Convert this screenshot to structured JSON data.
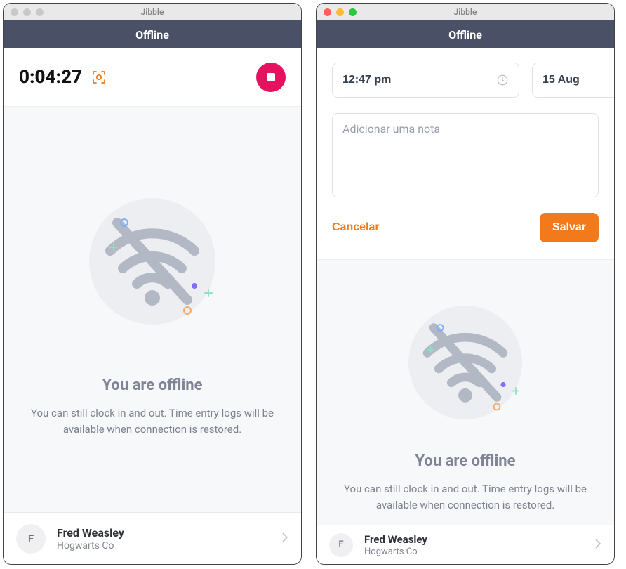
{
  "app_title": "Jibble",
  "status_label": "Offline",
  "left": {
    "timer": "0:04:27",
    "offline_heading": "You are offline",
    "offline_desc": "You can still clock in and out. Time entry logs will be available when connection is restored."
  },
  "right": {
    "time_value": "12:47 pm",
    "date_value": "15 Aug",
    "note_placeholder": "Adicionar uma nota",
    "cancel_label": "Cancelar",
    "save_label": "Salvar",
    "offline_heading": "You are offline",
    "offline_desc": "You can still clock in and out. Time entry logs will be available when connection is restored."
  },
  "user": {
    "initial": "F",
    "name": "Fred Weasley",
    "company": "Hogwarts Co"
  }
}
